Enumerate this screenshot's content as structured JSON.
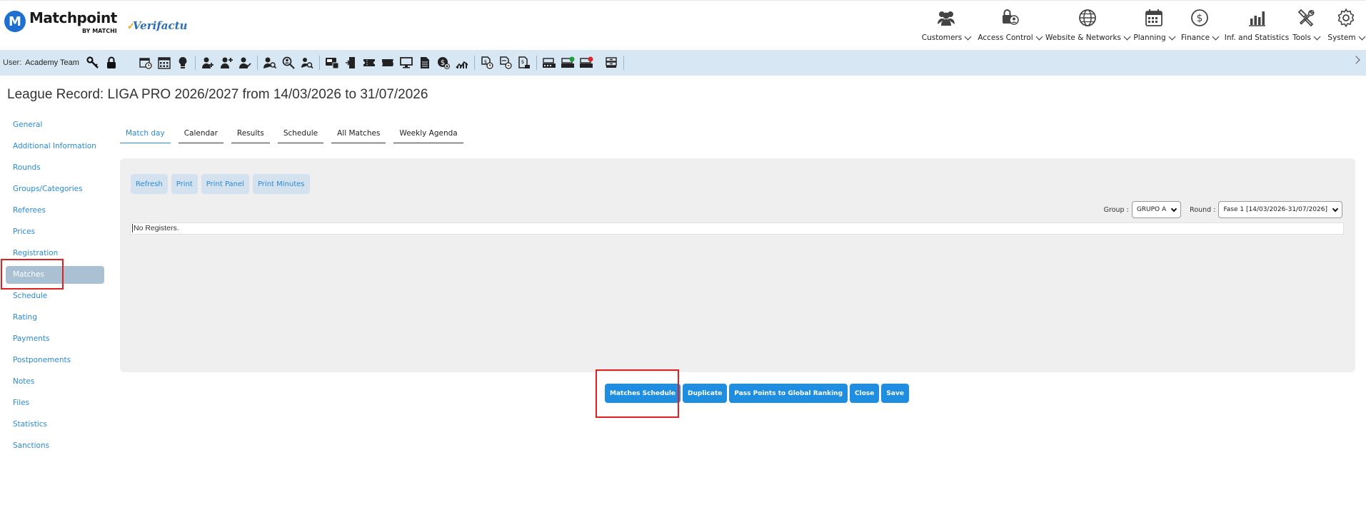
{
  "header": {
    "logo_letter": "M",
    "logo_name": "Matchpoint",
    "logo_sub": "BY MATCHI",
    "verifactu": "Verifactu",
    "nav": [
      {
        "label": "Customers",
        "icon": "customers-icon"
      },
      {
        "label": "Access Control",
        "icon": "access-control-icon"
      },
      {
        "label": "Website & Networks",
        "icon": "globe-icon"
      },
      {
        "label": "Planning",
        "icon": "calendar-icon"
      },
      {
        "label": "Finance",
        "icon": "dollar-icon"
      },
      {
        "label": "Inf. and Statistics",
        "icon": "bar-chart-icon"
      },
      {
        "label": "Tools",
        "icon": "tools-icon"
      },
      {
        "label": "System",
        "icon": "gear-icon"
      }
    ]
  },
  "toolbar": {
    "user_label": "User:",
    "user_name": "Academy Team"
  },
  "page": {
    "title": "League Record: LIGA PRO 2026/2027 from 14/03/2026 to 31/07/2026"
  },
  "sidebar": {
    "items": [
      {
        "label": "General"
      },
      {
        "label": "Additional Information"
      },
      {
        "label": "Rounds"
      },
      {
        "label": "Groups/Categories"
      },
      {
        "label": "Referees"
      },
      {
        "label": "Prices"
      },
      {
        "label": "Registration"
      },
      {
        "label": "Matches"
      },
      {
        "label": "Schedule"
      },
      {
        "label": "Rating"
      },
      {
        "label": "Payments"
      },
      {
        "label": "Postponements"
      },
      {
        "label": "Notes"
      },
      {
        "label": "Files"
      },
      {
        "label": "Statistics"
      },
      {
        "label": "Sanctions"
      }
    ],
    "active": "Matches"
  },
  "tabs": [
    {
      "label": "Match day"
    },
    {
      "label": "Calendar"
    },
    {
      "label": "Results"
    },
    {
      "label": "Schedule"
    },
    {
      "label": "All Matches"
    },
    {
      "label": "Weekly Agenda"
    }
  ],
  "panel": {
    "buttons": [
      "Refresh",
      "Print",
      "Print Panel",
      "Print Minutes"
    ],
    "group_label": "Group :",
    "group_value": "GRUPO A",
    "round_label": "Round :",
    "round_value": "Fase 1 [14/03/2026-31/07/2026]",
    "empty_text": "No Registers."
  },
  "actions": [
    "Matches Schedule",
    "Duplicate",
    "Pass Points to Global Ranking",
    "Close",
    "Save"
  ],
  "colors": {
    "accent": "#1f8ee0",
    "link": "#2b8ad6",
    "toolbar_bg": "#d7e7f3",
    "highlight": "#e02020"
  }
}
